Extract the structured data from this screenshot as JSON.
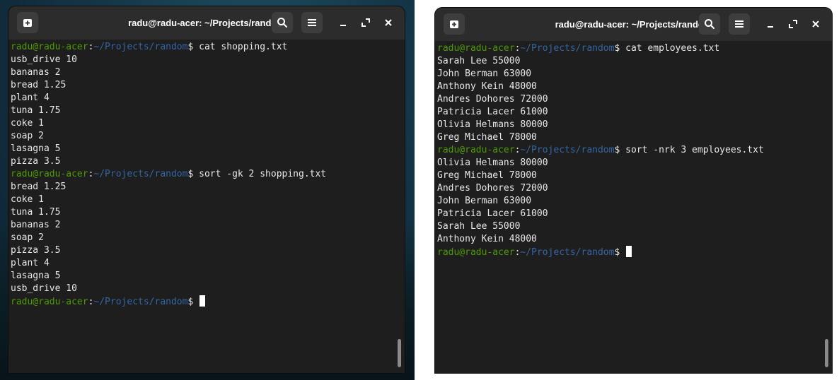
{
  "left_terminal": {
    "title": "radu@radu-acer: ~/Projects/random",
    "lines": [
      {
        "user": "radu@radu-acer",
        "sep": ":",
        "path": "~/Projects/random",
        "cmd": "$ cat shopping.txt"
      },
      {
        "text": "usb_drive 10"
      },
      {
        "text": "bananas 2"
      },
      {
        "text": "bread 1.25"
      },
      {
        "text": "plant 4"
      },
      {
        "text": "tuna 1.75"
      },
      {
        "text": "coke 1"
      },
      {
        "text": "soap 2"
      },
      {
        "text": "lasagna 5"
      },
      {
        "text": "pizza 3.5"
      },
      {
        "user": "radu@radu-acer",
        "sep": ":",
        "path": "~/Projects/random",
        "cmd": "$ sort -gk 2 shopping.txt"
      },
      {
        "text": "bread 1.25"
      },
      {
        "text": "coke 1"
      },
      {
        "text": "tuna 1.75"
      },
      {
        "text": "bananas 2"
      },
      {
        "text": "soap 2"
      },
      {
        "text": "pizza 3.5"
      },
      {
        "text": "plant 4"
      },
      {
        "text": "lasagna 5"
      },
      {
        "text": "usb_drive 10"
      },
      {
        "user": "radu@radu-acer",
        "sep": ":",
        "path": "~/Projects/random",
        "cmd": "$ ",
        "cursor": true
      }
    ]
  },
  "right_terminal": {
    "title": "radu@radu-acer: ~/Projects/random",
    "lines": [
      {
        "user": "radu@radu-acer",
        "sep": ":",
        "path": "~/Projects/random",
        "cmd": "$ cat employees.txt"
      },
      {
        "text": "Sarah Lee 55000"
      },
      {
        "text": "John Berman 63000"
      },
      {
        "text": "Anthony Kein 48000"
      },
      {
        "text": "Andres Dohores 72000"
      },
      {
        "text": "Patricia Lacer 61000"
      },
      {
        "text": "Olivia Helmans 80000"
      },
      {
        "text": "Greg Michael 78000"
      },
      {
        "user": "radu@radu-acer",
        "sep": ":",
        "path": "~/Projects/random",
        "cmd": "$ sort -nrk 3 employees.txt"
      },
      {
        "text": "Olivia Helmans 80000"
      },
      {
        "text": "Greg Michael 78000"
      },
      {
        "text": "Andres Dohores 72000"
      },
      {
        "text": "John Berman 63000"
      },
      {
        "text": "Patricia Lacer 61000"
      },
      {
        "text": "Sarah Lee 55000"
      },
      {
        "text": "Anthony Kein 48000"
      },
      {
        "user": "radu@radu-acer",
        "sep": ":",
        "path": "~/Projects/random",
        "cmd": "$ ",
        "cursor": true
      }
    ]
  },
  "colors": {
    "prompt_user": "#4e9a06",
    "prompt_path": "#3465a4",
    "terminal_bg": "#1e1e1e",
    "titlebar_bg": "#2c2c2c"
  },
  "icons": {
    "new_tab": "new-tab-icon",
    "search": "search-icon",
    "menu": "hamburger-menu-icon",
    "minimize": "minimize-icon",
    "maximize": "maximize-icon",
    "close": "close-icon"
  }
}
